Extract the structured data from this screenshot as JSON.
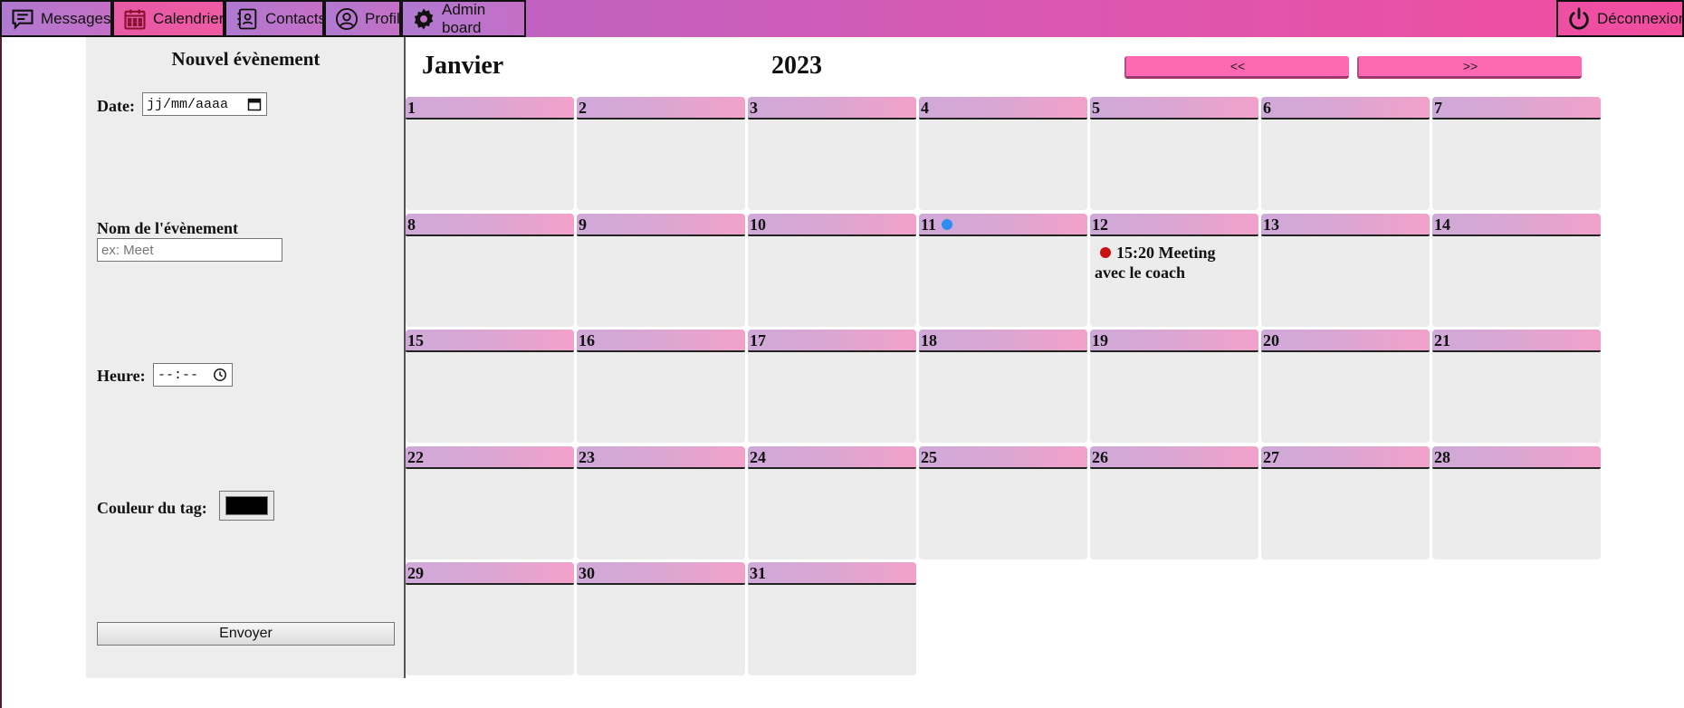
{
  "nav": {
    "items": [
      {
        "label": "Messages",
        "icon": "message-icon",
        "active": false
      },
      {
        "label": "Calendrier",
        "icon": "calendar-icon",
        "active": true
      },
      {
        "label": "Contacts",
        "icon": "contacts-icon",
        "active": false
      },
      {
        "label": "Profil",
        "icon": "user-icon",
        "active": false
      },
      {
        "label": "Admin board",
        "icon": "gear-icon",
        "active": false
      }
    ],
    "logout_label": "Déconnexion",
    "logout_icon": "power-icon"
  },
  "form": {
    "title": "Nouvel évènement",
    "date_label": "Date:",
    "date_value": "jj/mm/aaaa",
    "name_label": "Nom de l'évènement",
    "name_placeholder": "ex: Meet",
    "time_label": "Heure:",
    "time_value": "--:--",
    "color_label": "Couleur du tag:",
    "color_value": "#000000",
    "submit_label": "Envoyer"
  },
  "calendar": {
    "month": "Janvier",
    "year": "2023",
    "prev_label": "<<",
    "next_label": ">>",
    "days": [
      {
        "day": "1"
      },
      {
        "day": "2"
      },
      {
        "day": "3"
      },
      {
        "day": "4"
      },
      {
        "day": "5"
      },
      {
        "day": "6"
      },
      {
        "day": "7"
      },
      {
        "day": "8"
      },
      {
        "day": "9"
      },
      {
        "day": "10"
      },
      {
        "day": "11",
        "marker_color": "#2f8cf0"
      },
      {
        "day": "12",
        "event": {
          "time": "15:20",
          "title": "Meeting avec le coach",
          "color": "#cc1111"
        }
      },
      {
        "day": "13"
      },
      {
        "day": "14"
      },
      {
        "day": "15"
      },
      {
        "day": "16"
      },
      {
        "day": "17"
      },
      {
        "day": "18"
      },
      {
        "day": "19"
      },
      {
        "day": "20"
      },
      {
        "day": "21"
      },
      {
        "day": "22"
      },
      {
        "day": "23"
      },
      {
        "day": "24"
      },
      {
        "day": "25"
      },
      {
        "day": "26"
      },
      {
        "day": "27"
      },
      {
        "day": "28"
      },
      {
        "day": "29"
      },
      {
        "day": "30"
      },
      {
        "day": "31"
      }
    ]
  },
  "colors": {
    "nav_gradient_start": "#a77fcf",
    "nav_gradient_end": "#f24d9f",
    "nav_active": "#ef5aa4",
    "arrow_button": "#ff69b4",
    "cell_bg": "#ececec",
    "event_dot": "#cc1111",
    "marker_dot": "#2f8cf0"
  }
}
